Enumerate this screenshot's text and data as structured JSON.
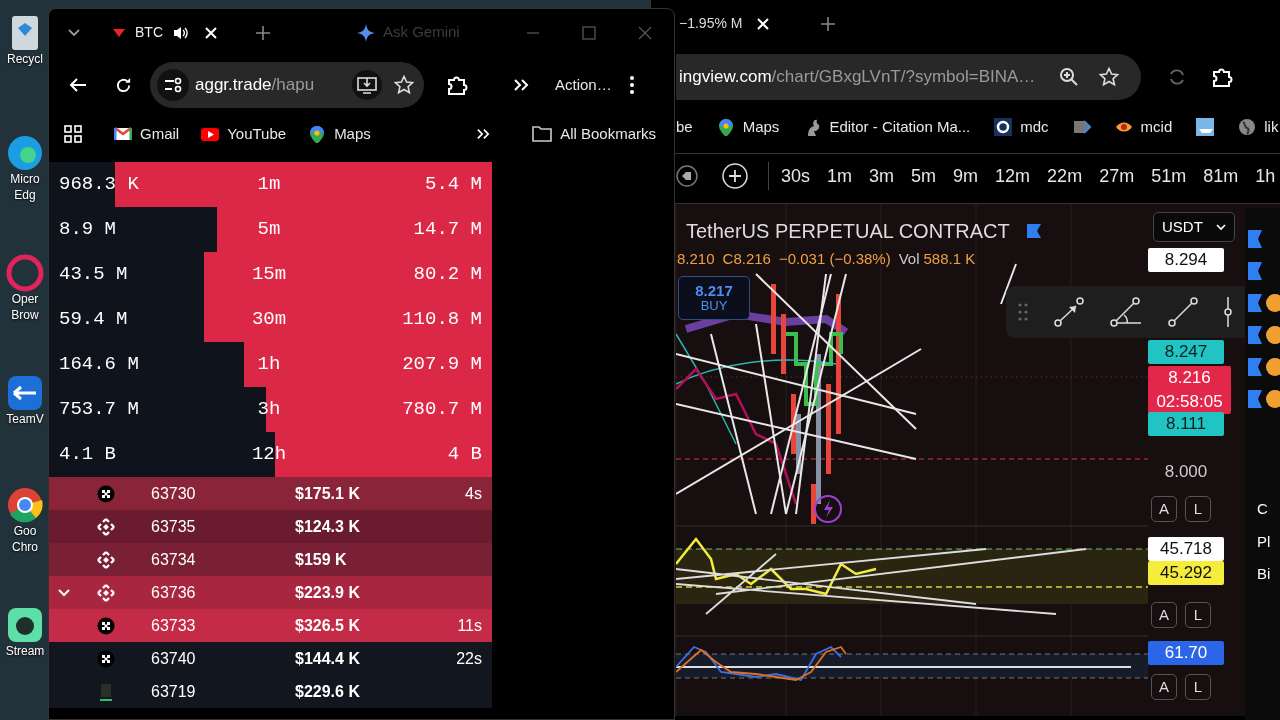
{
  "desktop": {
    "icons": [
      {
        "kind": "bin",
        "lines": [
          "Recycl"
        ]
      },
      {
        "kind": "edge",
        "lines": [
          "Micro",
          "Edg"
        ]
      },
      {
        "kind": "opera",
        "lines": [
          "Oper",
          "Brow"
        ]
      },
      {
        "kind": "remote",
        "lines": [
          "TeamV"
        ]
      },
      {
        "kind": "chrome",
        "lines": [
          "Goo",
          "Chro"
        ]
      },
      {
        "kind": "stream",
        "lines": [
          "Stream"
        ]
      }
    ]
  },
  "back_window": {
    "tab_title": "−1.95% M",
    "address": {
      "host": "ingview.com",
      "path": "/chart/GBxgLVnT/?symbol=BINA…"
    },
    "bookmarks": [
      {
        "kind": "none",
        "label": "be"
      },
      {
        "kind": "pin",
        "label": "Maps"
      },
      {
        "kind": "squirrel",
        "label": "Editor - Citation Ma..."
      },
      {
        "kind": "ring",
        "label": "mdc"
      },
      {
        "kind": "tag"
      },
      {
        "kind": "eye",
        "label": "mcid"
      },
      {
        "kind": "boat"
      },
      {
        "kind": "globe",
        "label": "lik"
      }
    ],
    "timeframes": [
      "30s",
      "1m",
      "3m",
      "5m",
      "9m",
      "12m",
      "22m",
      "27m",
      "51m",
      "81m",
      "1h"
    ],
    "chart": {
      "title": "TetherUS PERPETUAL CONTRACT",
      "ohlc": [
        "8.210",
        "C8.216",
        "−0.031 (−0.38%)"
      ],
      "vol_label": "Vol",
      "vol_value": "588.1 K",
      "buy_price": "8.217",
      "buy_label": "BUY",
      "currency": "USDT",
      "price_labels": [
        {
          "kind": "plain",
          "text": "8.294"
        },
        {
          "kind": "teal",
          "text": "8.247"
        },
        {
          "kind": "current",
          "text": "8.216",
          "sub": "02:58:05"
        },
        {
          "kind": "teal",
          "text": "8.111"
        },
        {
          "kind": "axis",
          "text": "8.000"
        },
        {
          "kind": "plain",
          "text": "45.718"
        },
        {
          "kind": "yellow",
          "text": "45.292"
        },
        {
          "kind": "blue",
          "text": "61.70"
        }
      ],
      "scale_buttons": [
        [
          "A",
          "L"
        ],
        [
          "A",
          "L"
        ],
        [
          "A",
          "L"
        ]
      ]
    },
    "side_labels": [
      "C",
      "Pl",
      "Bi"
    ]
  },
  "front_window": {
    "tab_title": "BTC",
    "ask": "Ask Gemini",
    "address": {
      "host": "aggr.trade",
      "path": "/hapu"
    },
    "action": "Action…",
    "bookmarks": [
      {
        "kind": "mail",
        "label": "Gmail"
      },
      {
        "kind": "video",
        "label": "YouTube"
      },
      {
        "kind": "pin",
        "label": "Maps"
      }
    ],
    "all_bookmarks": "All Bookmarks",
    "stats": [
      {
        "left": "968.3 K",
        "timeframe": "1m",
        "right": "5.4 M",
        "level": 0.85
      },
      {
        "left": "8.9 M",
        "timeframe": "5m",
        "right": "14.7 M",
        "level": 0.62
      },
      {
        "left": "43.5 M",
        "timeframe": "15m",
        "right": "80.2 M",
        "level": 0.65
      },
      {
        "left": "59.4 M",
        "timeframe": "30m",
        "right": "110.8 M",
        "level": 0.65
      },
      {
        "left": "164.6 M",
        "timeframe": "1h",
        "right": "207.9 M",
        "level": 0.56
      },
      {
        "left": "753.7 M",
        "timeframe": "3h",
        "right": "780.7 M",
        "level": 0.51
      },
      {
        "left": "4.1 B",
        "timeframe": "12h",
        "right": "4 B",
        "level": 0.49
      }
    ],
    "trades": [
      {
        "kind": "cross",
        "price": "63730",
        "amount": "$175.1 K",
        "time": "4s",
        "color": "#8a2439",
        "expanded": false
      },
      {
        "kind": "diamond",
        "price": "63735",
        "amount": "$124.3 K",
        "color": "#6a1c2e",
        "expanded": false
      },
      {
        "kind": "diamond",
        "price": "63734",
        "amount": "$159 K",
        "color": "#7a2034",
        "expanded": false
      },
      {
        "kind": "diamond",
        "price": "63736",
        "amount": "$223.9 K",
        "color": "#a8263f",
        "expanded": true
      },
      {
        "kind": "cross",
        "price": "63733",
        "amount": "$326.5 K",
        "time": "11s",
        "color": "#c42b47",
        "expanded": false
      },
      {
        "kind": "cross",
        "price": "63740",
        "amount": "$144.4 K",
        "time": "22s",
        "color": "#12161f",
        "expanded": false
      },
      {
        "kind": "block",
        "price": "63719",
        "amount": "$229.6 K",
        "color": "#12161f",
        "expanded": false
      }
    ]
  }
}
